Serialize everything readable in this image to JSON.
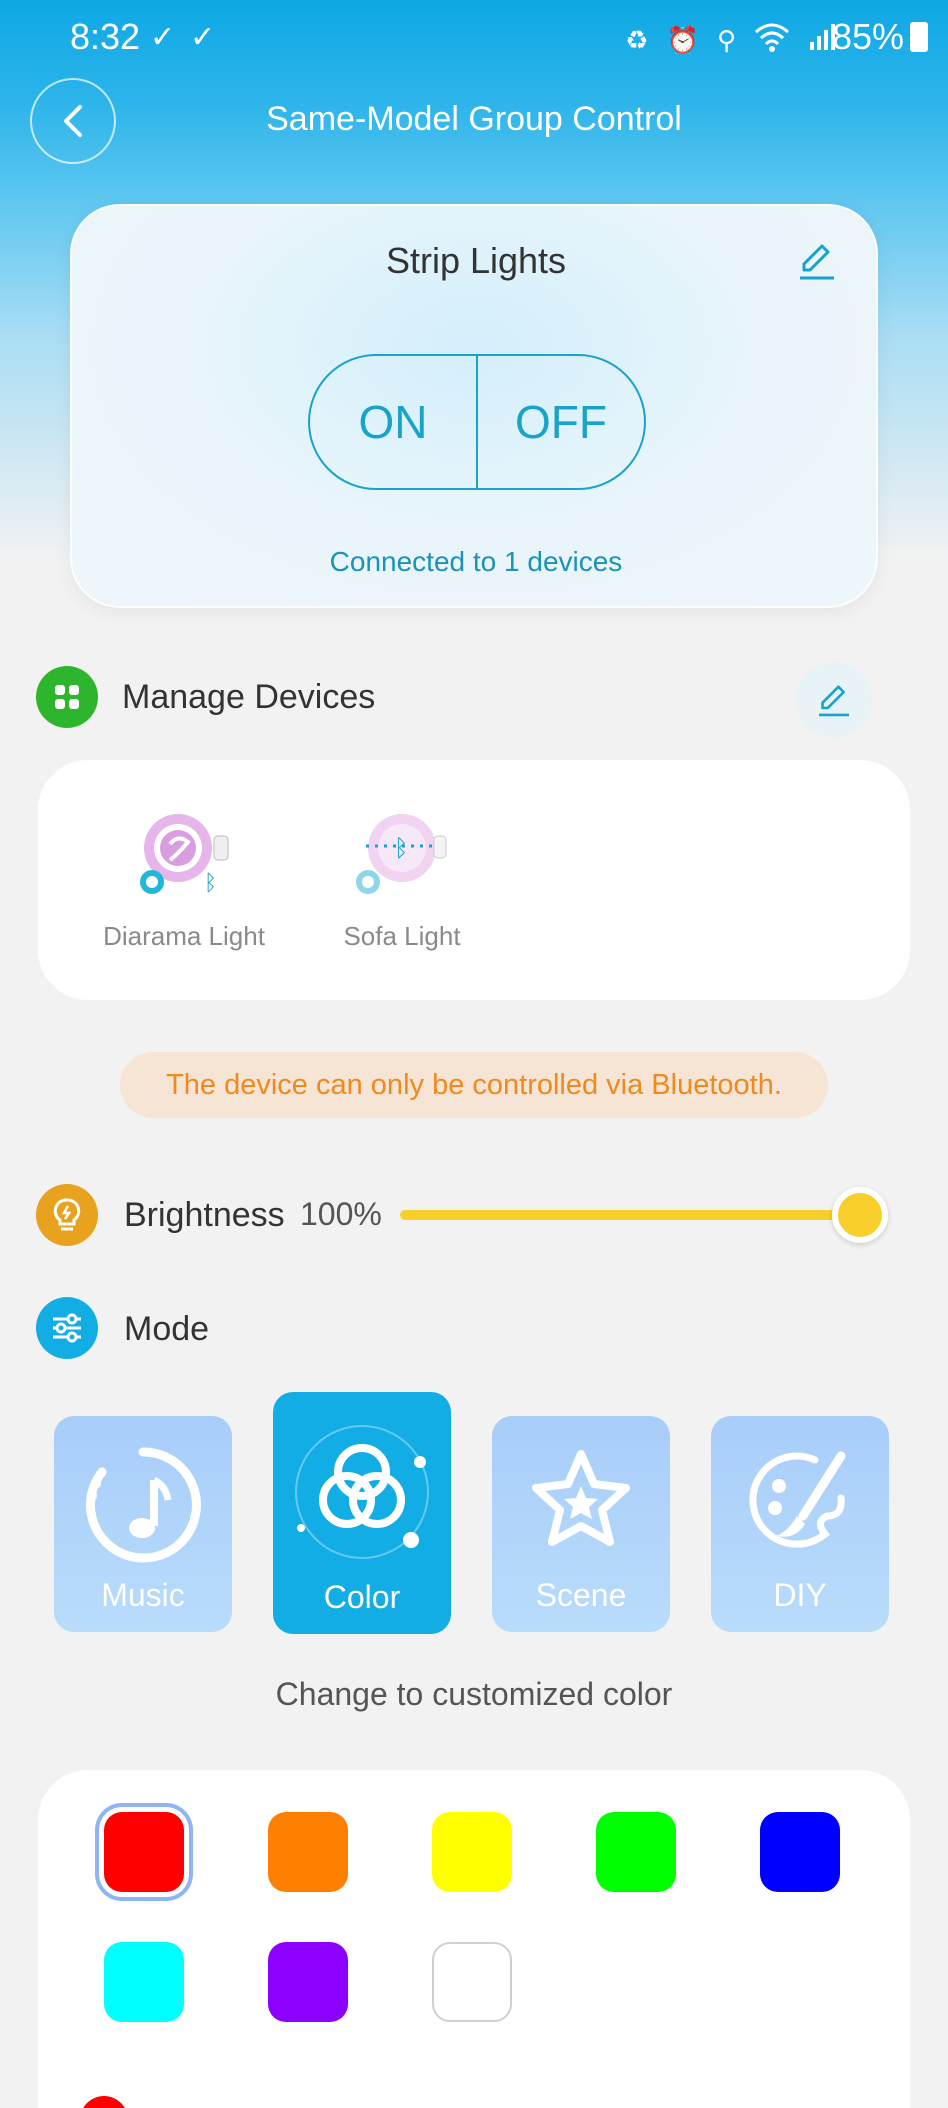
{
  "status_bar": {
    "time": "8:32",
    "battery": "85%"
  },
  "header": {
    "title": "Same-Model Group Control"
  },
  "group": {
    "name": "Strip Lights",
    "on_label": "ON",
    "off_label": "OFF",
    "connected_text": "Connected to 1 devices"
  },
  "manage_devices": {
    "label": "Manage Devices",
    "devices": [
      {
        "name": "Diarama Light"
      },
      {
        "name": "Sofa Light"
      }
    ]
  },
  "bluetooth_notice": "The device can only be controlled via Bluetooth.",
  "brightness": {
    "label": "Brightness",
    "value_text": "100%",
    "value": 100
  },
  "mode": {
    "label": "Mode",
    "tiles": [
      {
        "label": "Music",
        "icon": "music-icon",
        "active": false
      },
      {
        "label": "Color",
        "icon": "color-icon",
        "active": true
      },
      {
        "label": "Scene",
        "icon": "scene-icon",
        "active": false
      },
      {
        "label": "DIY",
        "icon": "diy-icon",
        "active": false
      }
    ],
    "caption": "Change to customized color"
  },
  "colors": {
    "swatches": [
      "#ff0000",
      "#ff7f00",
      "#ffff00",
      "#00ff00",
      "#0000ff",
      "#00ffff",
      "#8b00ff",
      "#ffffff"
    ],
    "selected_index": 0
  },
  "theme": {
    "accent": "#13ade6",
    "manage_icon": "#2db52d",
    "brightness_icon": "#e8a21e",
    "warning_text": "#ee8a1e"
  }
}
